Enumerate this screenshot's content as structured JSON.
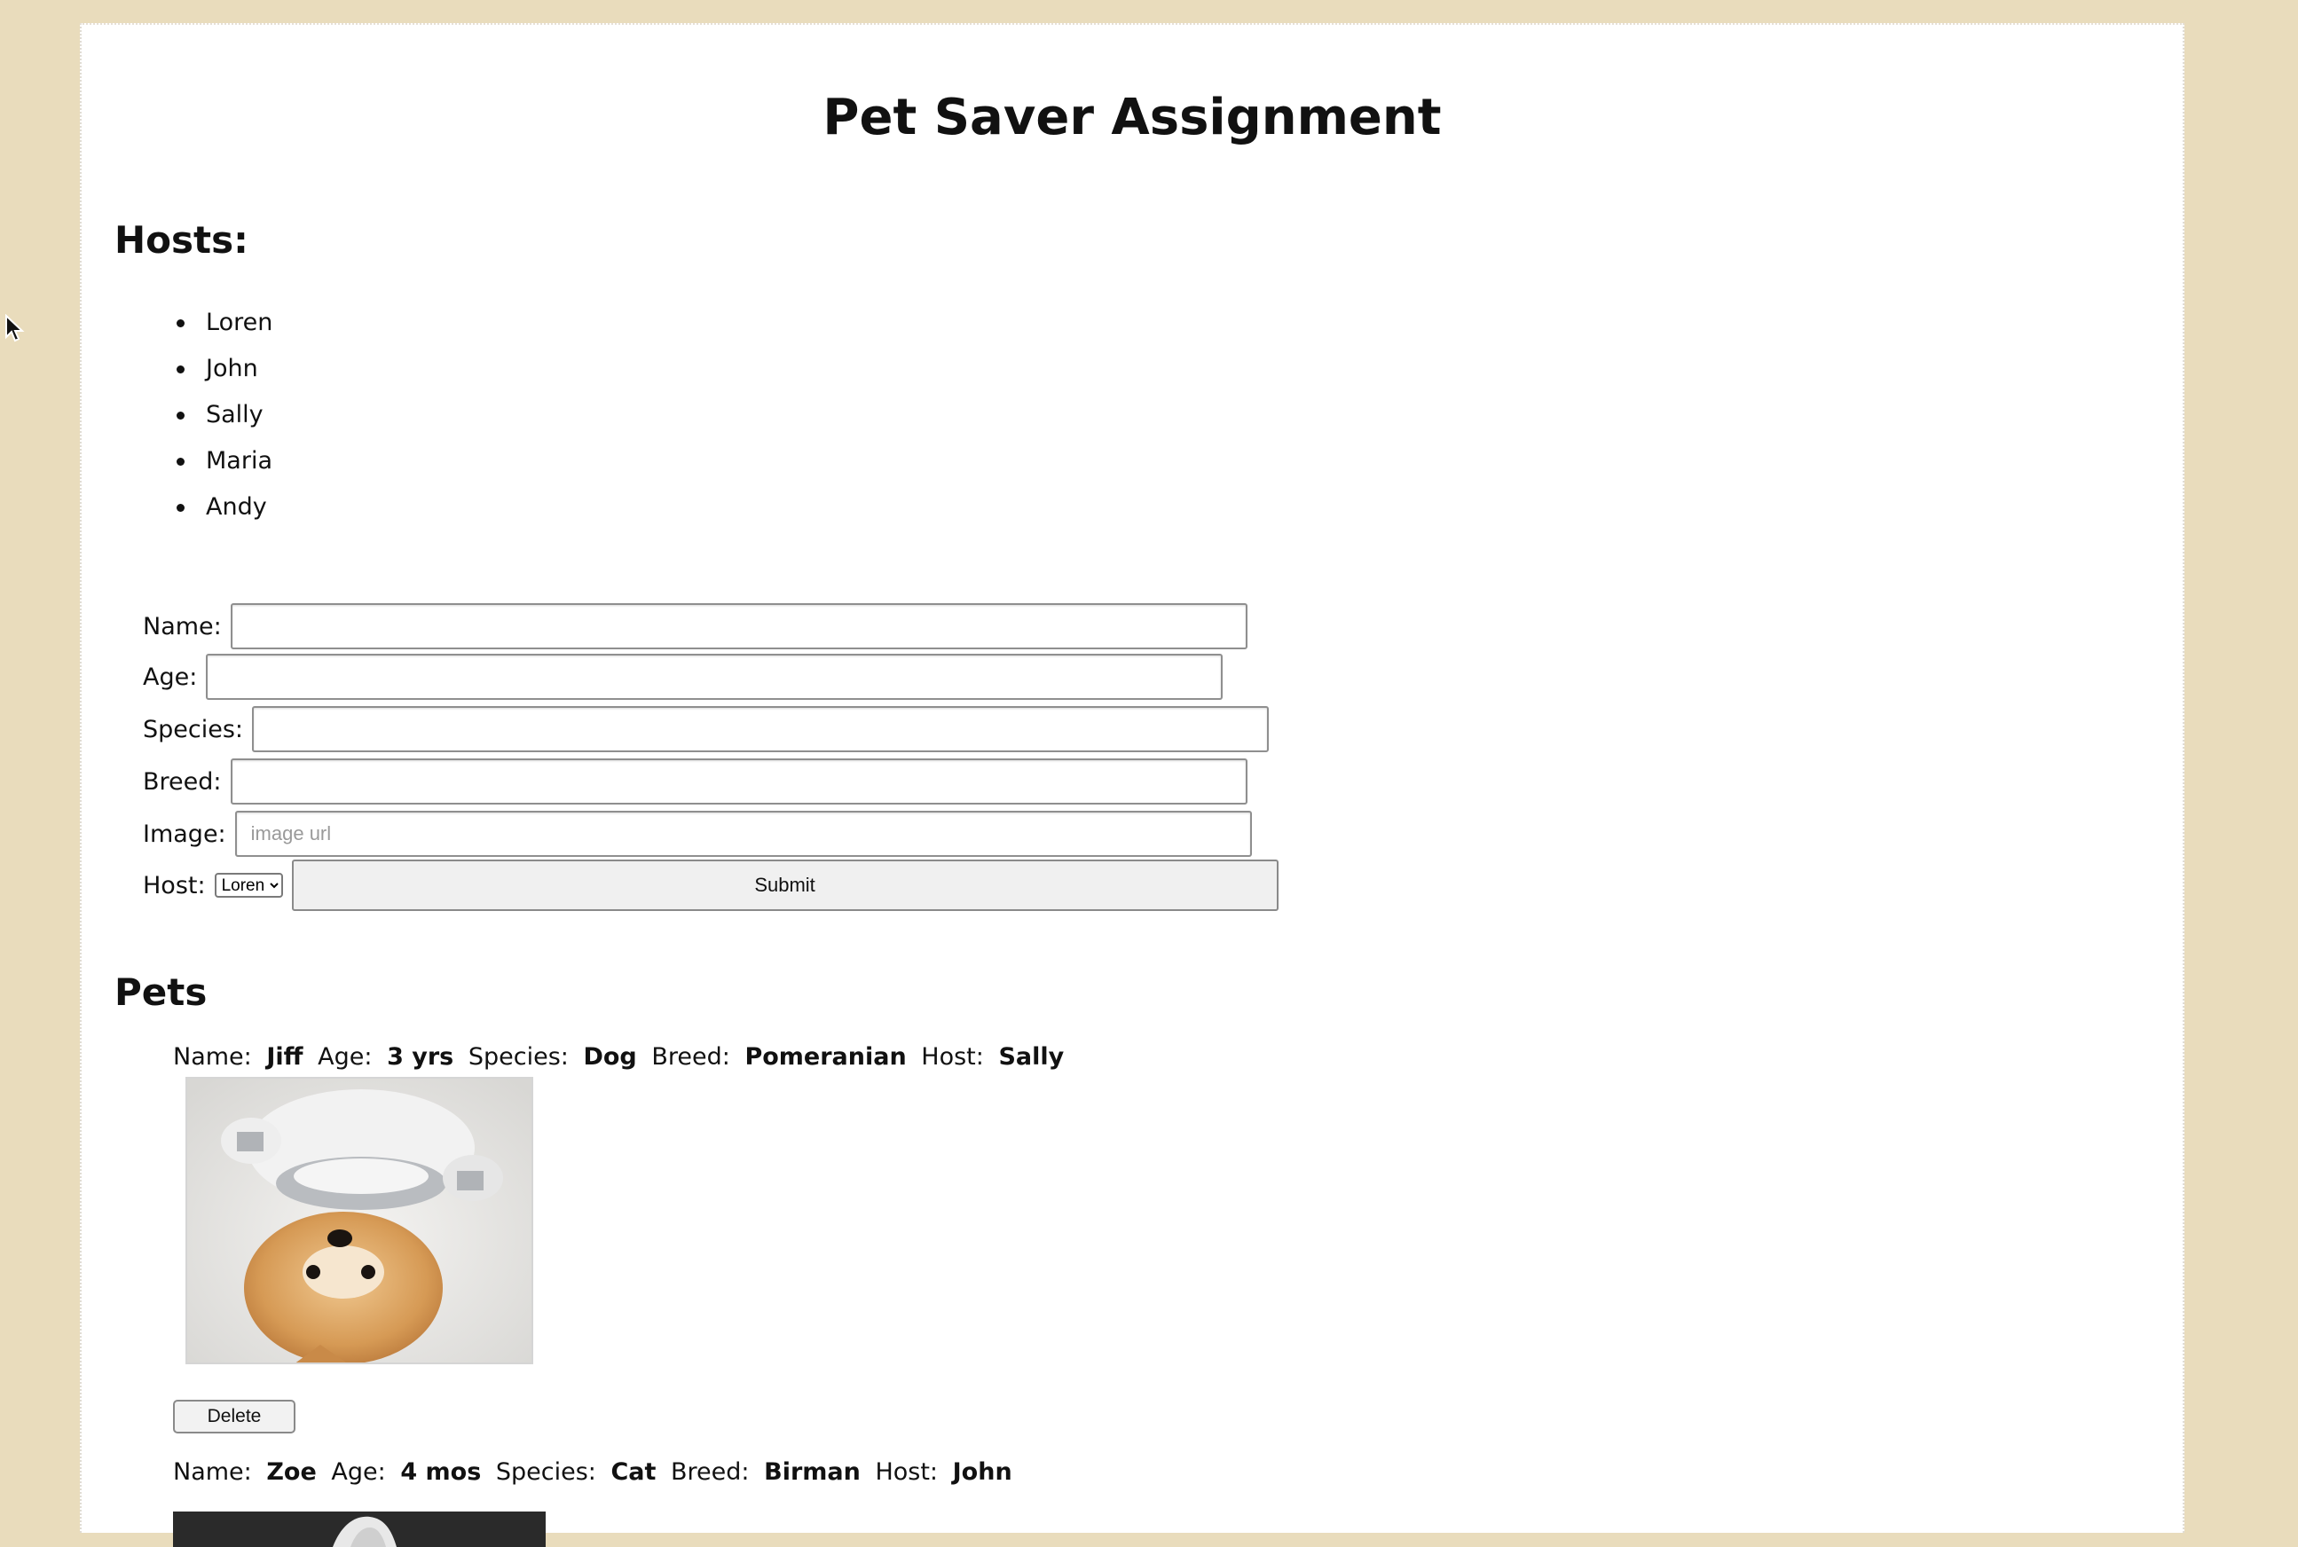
{
  "page": {
    "title": "Pet Saver Assignment"
  },
  "hosts": {
    "heading": "Hosts:",
    "items": [
      "Loren",
      "John",
      "Sally",
      "Maria",
      "Andy"
    ]
  },
  "form": {
    "name_label": "Name:",
    "name_value": "",
    "age_label": "Age:",
    "age_value": "",
    "species_label": "Species:",
    "species_value": "",
    "breed_label": "Breed:",
    "breed_value": "",
    "image_label": "Image:",
    "image_placeholder": "image url",
    "host_label": "Host:",
    "host_selected": "Loren",
    "submit_label": "Submit"
  },
  "pets": {
    "heading": "Pets",
    "field_labels": {
      "name": "Name:",
      "age": "Age:",
      "species": "Species:",
      "breed": "Breed:",
      "host": "Host:"
    },
    "items": [
      {
        "name": "Jiff",
        "age": "3 yrs",
        "species": "Dog",
        "breed": "Pomeranian",
        "host": "Sally",
        "delete_label": "Delete"
      },
      {
        "name": "Zoe",
        "age": "4 mos",
        "species": "Cat",
        "breed": "Birman",
        "host": "John"
      }
    ]
  },
  "colors": {
    "page_background": "#e9dcbc",
    "content_background": "#ffffff"
  },
  "icons": {
    "cursor": "mouse-pointer-icon",
    "dropdown": "chevron-down-icon"
  }
}
